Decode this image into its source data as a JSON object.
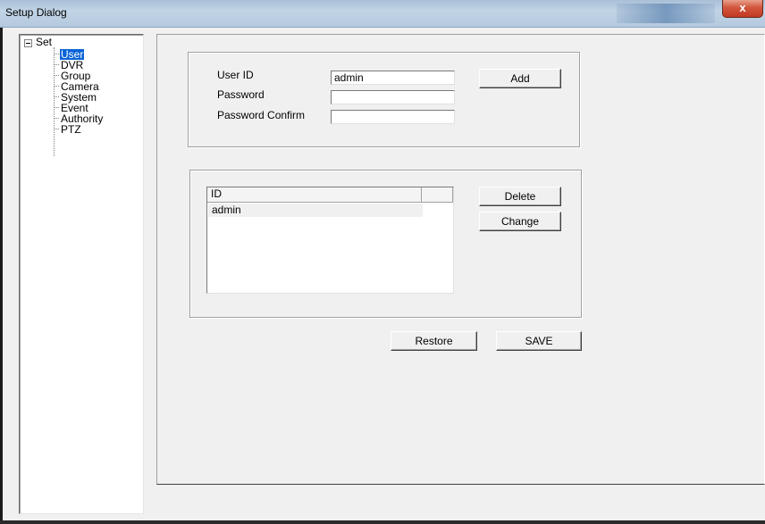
{
  "window": {
    "title": "Setup Dialog",
    "close_glyph": "x"
  },
  "tree": {
    "root": "Set",
    "items": [
      "User",
      "DVR",
      "Group",
      "Camera",
      "System",
      "Event",
      "Authority",
      "PTZ"
    ],
    "selected": "User"
  },
  "user_form": {
    "user_id_label": "User ID",
    "user_id_value": "admin",
    "password_label": "Password",
    "password_value": "",
    "password_confirm_label": "Password Confirm",
    "password_confirm_value": "",
    "add_button": "Add"
  },
  "user_list": {
    "column_header": "ID",
    "rows": [
      "admin"
    ],
    "delete_button": "Delete",
    "change_button": "Change"
  },
  "footer": {
    "restore_button": "Restore",
    "save_button": "SAVE"
  },
  "colors": {
    "selection": "#0a64d8",
    "titlebar": "#b4c9de",
    "close_button": "#c23a22",
    "dialog_bg": "#f0f0f0"
  },
  "icons": {
    "close": "close-icon",
    "collapse": "collapse-tree-icon"
  }
}
